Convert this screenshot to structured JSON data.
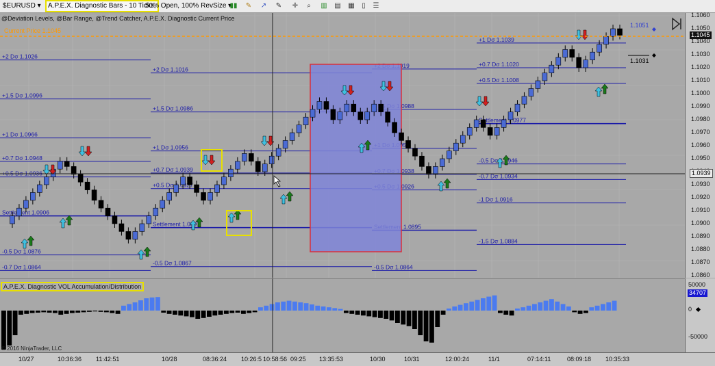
{
  "toolbar": {
    "instrument": "$EURUSD",
    "chart_title": "A.P.E.X. Diagnostic Bars - 10 Ticks,",
    "chart_settings": "50% Open, 100% RevSize"
  },
  "studies_label": "@Deviation Levels, @Bar Range, @Trend Catcher, A.P.E.X. Diagnostic Current Price",
  "indicator_label": "A.P.E.X. Diagnostic VOL Accumulation/Distribution",
  "copyright": "© 2016 NinjaTrader, LLC",
  "colors": {
    "background": "#a8a8a8",
    "up_bar": "#4b6bd4",
    "down_bar": "#000000",
    "level_line": "#1a1aa8",
    "current_price_line": "#ff9900",
    "highlight_box": "#7f85d8",
    "highlight_border": "#d8303a",
    "badge_fill": "#1818d0",
    "vol_up": "#4b7bf0",
    "vol_down": "#000000"
  },
  "price_axis": {
    "ticks": [
      "1.1060",
      "1.1050",
      "1.1040",
      "1.1030",
      "1.1020",
      "1.1010",
      "1.1000",
      "1.0990",
      "1.0980",
      "1.0970",
      "1.0960",
      "1.0950",
      "1.0940",
      "1.0930",
      "1.0920",
      "1.0910",
      "1.0900",
      "1.0890",
      "1.0880",
      "1.0870",
      "1.0860"
    ],
    "current_price": "1.1045",
    "crosshair_price": "1.0939"
  },
  "indicator_axis": {
    "ticks": [
      "50000",
      "0",
      "-50000"
    ],
    "current_value": "34707"
  },
  "time_axis": [
    "10/27",
    "10:36:36",
    "11:42:51",
    "10/28",
    "08:36:24",
    "10:26:5",
    "10:58:56",
    "09:25",
    "13:35:53",
    "10/30",
    "10/31",
    "12:00:24",
    "11/1",
    "07:14:11",
    "08:09:18",
    "10:35:33"
  ],
  "current_price_label": "Current Price 1.1045",
  "projection_labels": [
    "1.1051",
    "1.1031"
  ],
  "deviation_levels": [
    {
      "label": "+2 Dσ 1.1026"
    },
    {
      "label": "+1.5 Dσ 1.0996"
    },
    {
      "label": "+1 Dσ 1.0966"
    },
    {
      "label": "+0.7 Dσ 1.0948"
    },
    {
      "label": "+0.5 Dσ 1.0936"
    },
    {
      "label": "Settlement 1.0906"
    },
    {
      "label": "-0.5 Dσ 1.0876"
    },
    {
      "label": "-0.7 Dσ 1.0864"
    },
    {
      "label": "+2 Dσ 1.1016"
    },
    {
      "label": "+1.5 Dσ 1.0986"
    },
    {
      "label": "+1 Dσ 1.0956"
    },
    {
      "label": "+0.7 Dσ 1.0939"
    },
    {
      "label": "+0.5 Dσ 1.0927"
    },
    {
      "label": "Settlement 1.0897"
    },
    {
      "label": "-0.5 Dσ 1.0867"
    },
    {
      "label": "+2 Dσ 1.1019"
    },
    {
      "label": "+1.5 Dσ 1.0988"
    },
    {
      "label": "+1 Dσ 1.0958"
    },
    {
      "label": "+0.7 Dσ 1.0938"
    },
    {
      "label": "+0.5 Dσ 1.0926"
    },
    {
      "label": "Settlement 1.0895"
    },
    {
      "label": "-0.5 Dσ 1.0864"
    },
    {
      "label": "+1 Dσ 1.1039"
    },
    {
      "label": "+0.7 Dσ 1.1020"
    },
    {
      "label": "+0.5 Dσ 1.1008"
    },
    {
      "label": "Settlement 1.0977"
    },
    {
      "label": "-0.5 Dσ 1.0946"
    },
    {
      "label": "-0.7 Dσ 1.0934"
    },
    {
      "label": "-1 Dσ 1.0916"
    },
    {
      "label": "-1.5 Dσ 1.0884"
    }
  ]
}
